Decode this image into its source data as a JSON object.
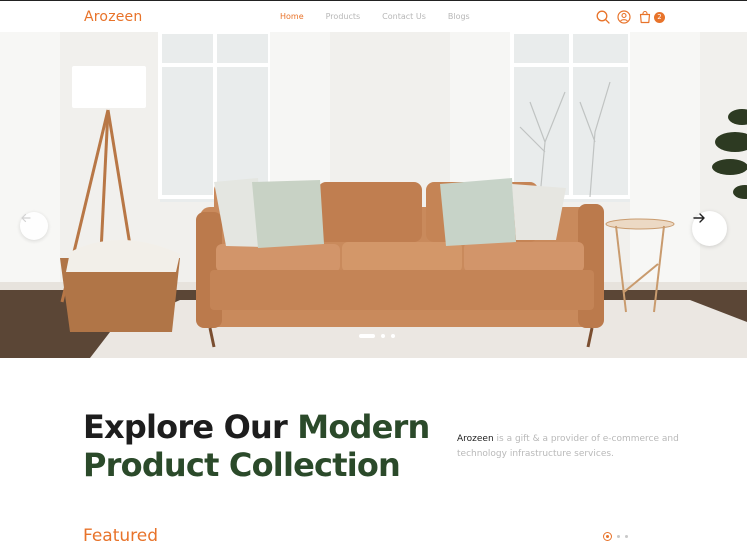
{
  "header": {
    "logo": "Arozeen",
    "nav": [
      {
        "label": "Home",
        "active": true
      },
      {
        "label": "Products",
        "active": false
      },
      {
        "label": "Contact Us",
        "active": false
      },
      {
        "label": "Blogs",
        "active": false
      }
    ],
    "icons": [
      "search-icon",
      "user-icon",
      "cart-icon"
    ],
    "cart_count": "2"
  },
  "hero": {
    "slides_total": 3,
    "active_slide": 1
  },
  "explore": {
    "title_part1": "Explore Our ",
    "title_part2": "Modern",
    "title_part3": "Product Collection",
    "brand": "Arozeen",
    "description": " is a gift & a provider of e-commerce and technology infrastructure services."
  },
  "featured": {
    "title": "Featured"
  },
  "colors": {
    "accent": "#e8732a",
    "green": "#2b4a2a"
  }
}
